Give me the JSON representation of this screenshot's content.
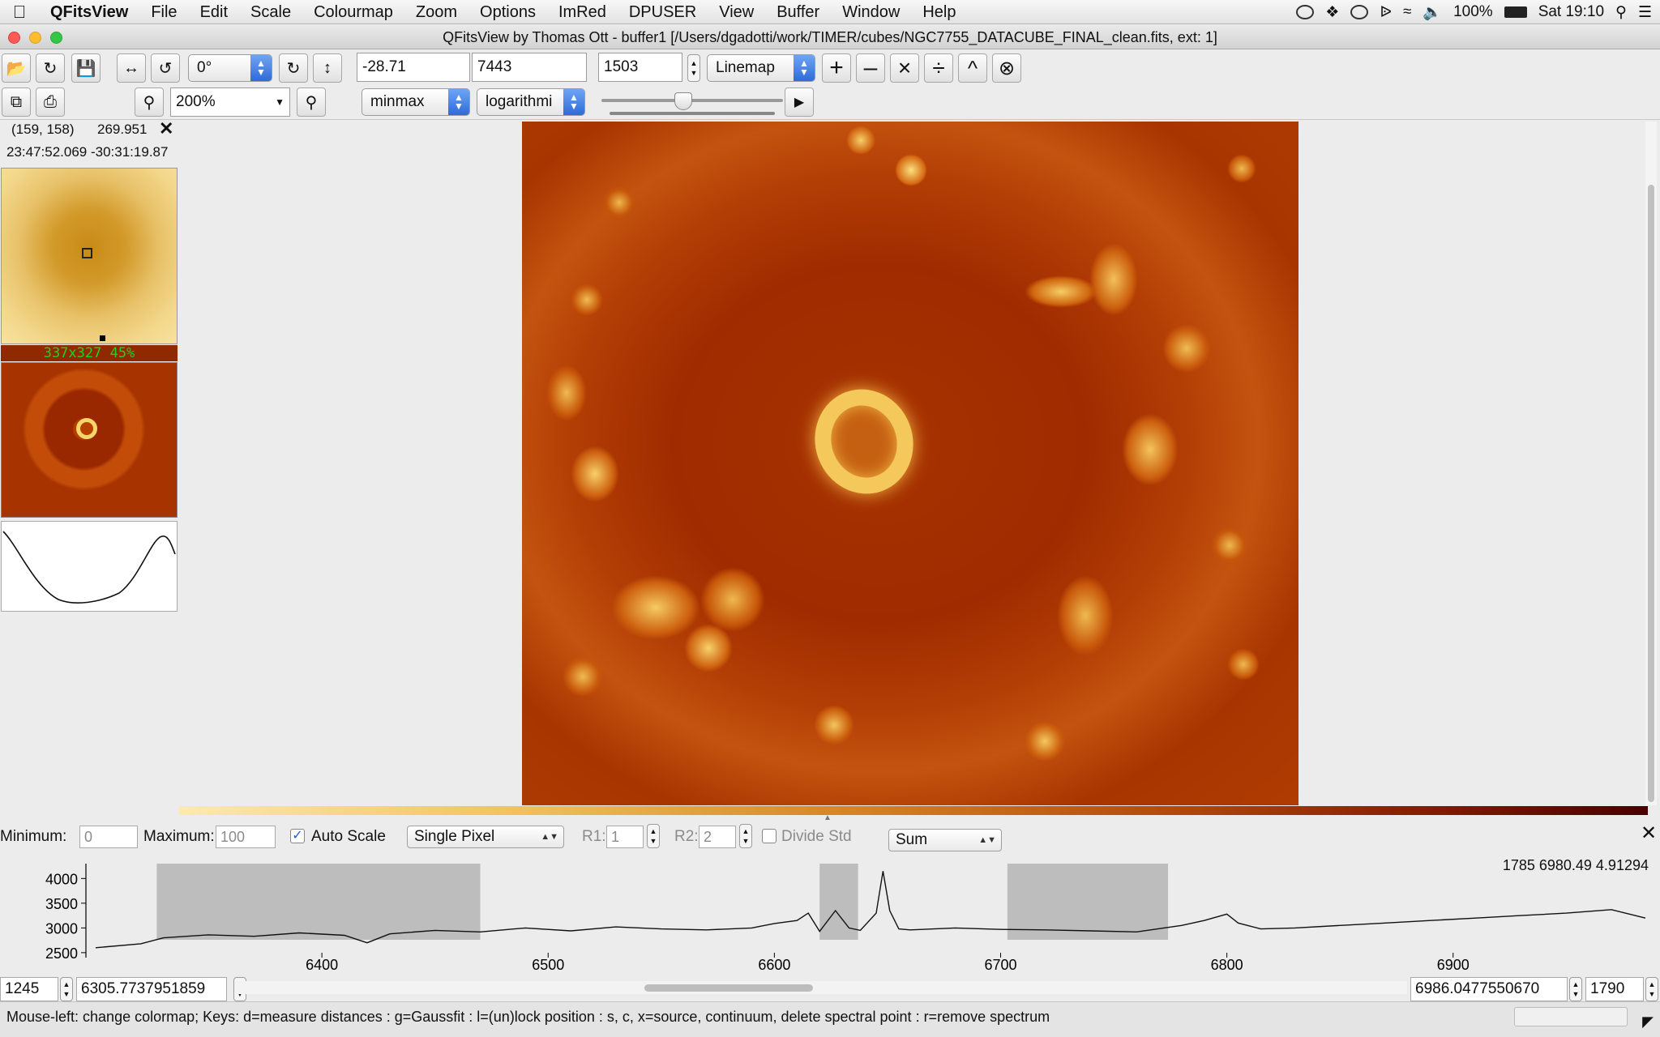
{
  "menubar": {
    "app_name": "QFitsView",
    "items": [
      "File",
      "Edit",
      "Scale",
      "Colourmap",
      "Zoom",
      "Options",
      "ImRed",
      "DPUSER",
      "View",
      "Buffer",
      "Window",
      "Help"
    ],
    "battery": "100%",
    "clock": "Sat 19:10"
  },
  "window": {
    "title": "QFitsView by Thomas Ott - buffer1 [/Users/dgadotti/work/TIMER/cubes/NGC7755_DATACUBE_FINAL_clean.fits, ext: 1]"
  },
  "toolbar": {
    "rotation": "0°",
    "range_min": "-28.71",
    "range_max": "7443",
    "channel": "1503",
    "mode": "Linemap",
    "zoom": "200%",
    "scale_method": "minmax",
    "scale_type": "logarithmi",
    "slider_position": 0.45
  },
  "left_panel": {
    "pixel_coords": "(159, 158)",
    "pixel_value": "269.951",
    "wcs_coords": "23:47:52.069 -30:31:19.87",
    "thumbnail_info": "337x327  45%"
  },
  "spectrum_controls": {
    "min_label": "Minimum:",
    "min_value": "0",
    "max_label": "Maximum:",
    "max_value": "100",
    "auto_scale_label": "Auto Scale",
    "auto_scale_checked": true,
    "extraction_mode": "Single Pixel",
    "r1_label": "R1:",
    "r1_value": "1",
    "r2_label": "R2:",
    "r2_value": "2",
    "divide_std_label": "Divide Std",
    "combine_method": "Sum"
  },
  "spectrum_plot": {
    "cursor_readout": "1785 6980.49 4.91294",
    "y_ticks": [
      "4000",
      "3500",
      "3000",
      "2500"
    ],
    "x_ticks": [
      "6400",
      "6500",
      "6600",
      "6700",
      "6800",
      "6900"
    ]
  },
  "chart_data": {
    "type": "line",
    "xlabel": "",
    "ylabel": "",
    "xlim": [
      6300,
      6985
    ],
    "ylim": [
      2400,
      4300
    ],
    "shaded_regions": [
      [
        6327,
        6470
      ],
      [
        6620,
        6637
      ],
      [
        6703,
        6774
      ]
    ],
    "x": [
      6300,
      6320,
      6330,
      6350,
      6370,
      6390,
      6410,
      6420,
      6430,
      6450,
      6470,
      6490,
      6510,
      6530,
      6550,
      6570,
      6590,
      6600,
      6610,
      6615,
      6620,
      6627,
      6633,
      6638,
      6645,
      6648,
      6651,
      6655,
      6660,
      6680,
      6700,
      6720,
      6740,
      6760,
      6780,
      6790,
      6800,
      6805,
      6815,
      6830,
      6850,
      6870,
      6890,
      6910,
      6930,
      6950,
      6970,
      6985
    ],
    "y": [
      2600,
      2680,
      2800,
      2860,
      2830,
      2900,
      2850,
      2700,
      2880,
      2950,
      2920,
      3000,
      2940,
      3020,
      2980,
      2960,
      3000,
      3090,
      3150,
      3300,
      2930,
      3350,
      3000,
      2950,
      3300,
      4150,
      3350,
      2980,
      2960,
      3000,
      2970,
      2960,
      2940,
      2920,
      3050,
      3150,
      3280,
      3100,
      2980,
      3000,
      3050,
      3100,
      3150,
      3200,
      3250,
      3300,
      3370,
      3200
    ]
  },
  "range_row": {
    "start_channel": "1245",
    "start_wavelength": "6305.7737951859",
    "end_wavelength": "6986.0477550670",
    "end_channel": "1790"
  },
  "statusbar": {
    "text": "Mouse-left: change colormap; Keys: d=measure distances : g=Gaussfit : l=(un)lock position : s, c, x=source, continuum, delete spectral point : r=remove spectrum"
  },
  "colors": {
    "image_base": "#a63300",
    "image_bright": "#f7d16a",
    "combo_accent": "#2f6bd9"
  }
}
